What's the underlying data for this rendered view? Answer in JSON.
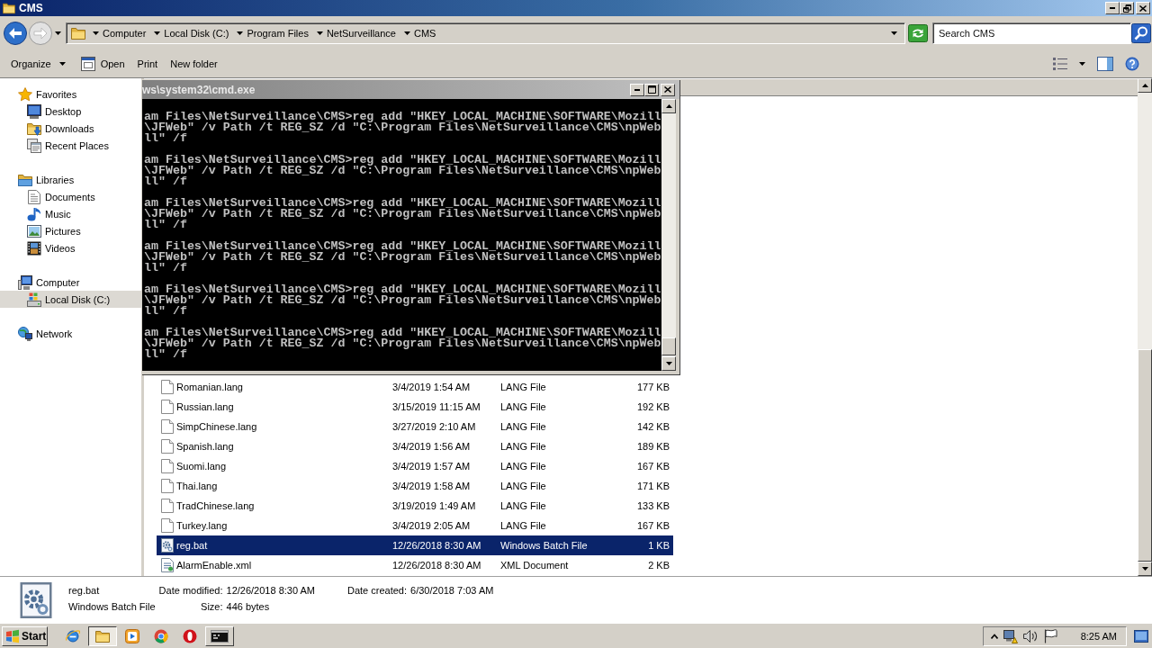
{
  "window": {
    "title": "CMS"
  },
  "navigation": {
    "breadcrumbs": [
      "Computer",
      "Local Disk (C:)",
      "Program Files",
      "NetSurveillance",
      "CMS"
    ]
  },
  "search": {
    "placeholder": "Search CMS"
  },
  "toolbar": {
    "buttons": [
      {
        "label": "Organize",
        "kind": "menu"
      },
      {
        "label": "Open",
        "kind": "open"
      },
      {
        "label": "Print",
        "kind": "plain"
      },
      {
        "label": "New folder",
        "kind": "plain"
      }
    ]
  },
  "sidebar": {
    "items": [
      {
        "label": "Favorites",
        "kind": "favorites",
        "selected": false,
        "children": [
          {
            "label": "Desktop",
            "kind": "desktop",
            "selected": false
          },
          {
            "label": "Downloads",
            "kind": "downloads",
            "selected": false
          },
          {
            "label": "Recent Places",
            "kind": "recent",
            "selected": false
          }
        ]
      },
      {
        "label": "Libraries",
        "kind": "libraries",
        "selected": false,
        "children": [
          {
            "label": "Documents",
            "kind": "documents",
            "selected": false
          },
          {
            "label": "Music",
            "kind": "music",
            "selected": false
          },
          {
            "label": "Pictures",
            "kind": "pictures",
            "selected": false
          },
          {
            "label": "Videos",
            "kind": "videos",
            "selected": false
          }
        ]
      },
      {
        "label": "Computer",
        "kind": "computer",
        "selected": false,
        "children": [
          {
            "label": "Local Disk (C:)",
            "kind": "drive",
            "selected": true
          }
        ]
      },
      {
        "label": "Network",
        "kind": "network",
        "selected": false
      }
    ]
  },
  "file_list": {
    "rows": [
      {
        "name": "Romanian.lang",
        "date": "3/4/2019 1:54 AM",
        "type": "LANG File",
        "size": "177 KB",
        "kind": "lang",
        "selected": false
      },
      {
        "name": "Russian.lang",
        "date": "3/15/2019 11:15 AM",
        "type": "LANG File",
        "size": "192 KB",
        "kind": "lang",
        "selected": false
      },
      {
        "name": "SimpChinese.lang",
        "date": "3/27/2019 2:10 AM",
        "type": "LANG File",
        "size": "142 KB",
        "kind": "lang",
        "selected": false
      },
      {
        "name": "Spanish.lang",
        "date": "3/4/2019 1:56 AM",
        "type": "LANG File",
        "size": "189 KB",
        "kind": "lang",
        "selected": false
      },
      {
        "name": "Suomi.lang",
        "date": "3/4/2019 1:57 AM",
        "type": "LANG File",
        "size": "167 KB",
        "kind": "lang",
        "selected": false
      },
      {
        "name": "Thai.lang",
        "date": "3/4/2019 1:58 AM",
        "type": "LANG File",
        "size": "171 KB",
        "kind": "lang",
        "selected": false
      },
      {
        "name": "TradChinese.lang",
        "date": "3/19/2019 1:49 AM",
        "type": "LANG File",
        "size": "133 KB",
        "kind": "lang",
        "selected": false
      },
      {
        "name": "Turkey.lang",
        "date": "3/4/2019 2:05 AM",
        "type": "LANG File",
        "size": "167 KB",
        "kind": "lang",
        "selected": false
      },
      {
        "name": "reg.bat",
        "date": "12/26/2018 8:30 AM",
        "type": "Windows Batch File",
        "size": "1 KB",
        "kind": "batch",
        "selected": true
      },
      {
        "name": "AlarmEnable.xml",
        "date": "12/26/2018 8:30 AM",
        "type": "XML Document",
        "size": "2 KB",
        "kind": "xml",
        "selected": false
      }
    ]
  },
  "console_window": {
    "title": "ws\\system32\\cmd.exe",
    "blocks": [
      {
        "lines": [
          "am Files\\NetSurveillance\\CMS>reg add \"HKEY_LOCAL_MACHINE\\SOFTWARE\\Mozill",
          "\\JFWeb\" /v Path /t REG_SZ /d \"C:\\Program Files\\NetSurveillance\\CMS\\npWeb",
          "ll\" /f"
        ]
      },
      {
        "lines": [
          "am Files\\NetSurveillance\\CMS>reg add \"HKEY_LOCAL_MACHINE\\SOFTWARE\\Mozill",
          "\\JFWeb\" /v Path /t REG_SZ /d \"C:\\Program Files\\NetSurveillance\\CMS\\npWeb",
          "ll\" /f"
        ]
      },
      {
        "lines": [
          "am Files\\NetSurveillance\\CMS>reg add \"HKEY_LOCAL_MACHINE\\SOFTWARE\\Mozill",
          "\\JFWeb\" /v Path /t REG_SZ /d \"C:\\Program Files\\NetSurveillance\\CMS\\npWeb",
          "ll\" /f"
        ]
      },
      {
        "lines": [
          "am Files\\NetSurveillance\\CMS>reg add \"HKEY_LOCAL_MACHINE\\SOFTWARE\\Mozill",
          "\\JFWeb\" /v Path /t REG_SZ /d \"C:\\Program Files\\NetSurveillance\\CMS\\npWeb",
          "ll\" /f"
        ]
      },
      {
        "lines": [
          "am Files\\NetSurveillance\\CMS>reg add \"HKEY_LOCAL_MACHINE\\SOFTWARE\\Mozill",
          "\\JFWeb\" /v Path /t REG_SZ /d \"C:\\Program Files\\NetSurveillance\\CMS\\npWeb",
          "ll\" /f"
        ]
      },
      {
        "lines": [
          "am Files\\NetSurveillance\\CMS>reg add \"HKEY_LOCAL_MACHINE\\SOFTWARE\\Mozill",
          "\\JFWeb\" /v Path /t REG_SZ /d \"C:\\Program Files\\NetSurveillance\\CMS\\npWeb",
          "ll\" /f"
        ]
      }
    ]
  },
  "details_pane": {
    "name": "reg.bat",
    "type": "Windows Batch File",
    "kind": "batch",
    "fields": [
      {
        "label": "Date modified:",
        "value": "12/26/2018 8:30 AM"
      },
      {
        "label": "Date created:",
        "value": "6/30/2018 7:03 AM"
      },
      {
        "label": "Size:",
        "value": "446 bytes"
      }
    ]
  },
  "taskbar": {
    "start": "Start",
    "apps": [
      {
        "kind": "globe",
        "open": false,
        "selected": false
      },
      {
        "kind": "folder",
        "open": true,
        "selected": true
      },
      {
        "kind": "play",
        "open": false,
        "selected": false
      },
      {
        "kind": "wheel",
        "open": false,
        "selected": false
      },
      {
        "kind": "ring",
        "open": false,
        "selected": false
      },
      {
        "kind": "terminal",
        "open": true,
        "selected": false
      }
    ],
    "clock": "8:25 AM"
  }
}
